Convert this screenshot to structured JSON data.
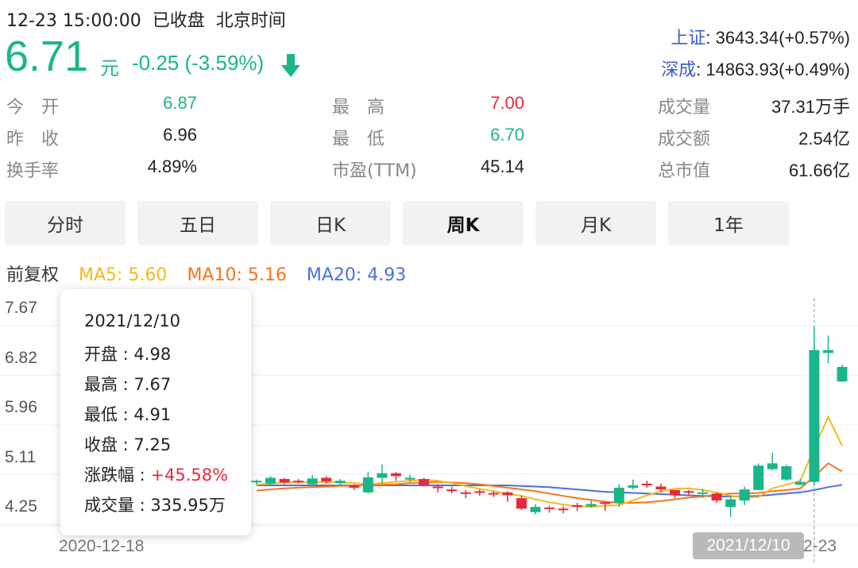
{
  "header": {
    "datetime": "12-23 15:00:00",
    "status": "已收盘",
    "timezone": "北京时间",
    "price": "6.71",
    "unit": "元",
    "change": "-0.25 (-3.59%)",
    "direction_icon": "arrow-down-icon",
    "down_color": "#1bb58a",
    "up_color": "#e8293c"
  },
  "indices": [
    {
      "name": "上证",
      "value": ": 3643.34(+0.57%)"
    },
    {
      "name": "深成",
      "value": ": 14863.93(+0.49%)"
    }
  ],
  "stats": [
    {
      "label": "今　开",
      "value": "6.87",
      "color": "#1bb58a"
    },
    {
      "label": "昨　收",
      "value": "6.96",
      "color": "#222222"
    },
    {
      "label": "换手率",
      "value": "4.89%",
      "color": "#222222"
    },
    {
      "label": "最　高",
      "value": "7.00",
      "color": "#e8293c"
    },
    {
      "label": "最　低",
      "value": "6.70",
      "color": "#1bb58a"
    },
    {
      "label": "市盈(TTM)",
      "value": "45.14",
      "color": "#222222"
    },
    {
      "label": "成交量",
      "value": "37.31万手",
      "color": "#222222"
    },
    {
      "label": "成交额",
      "value": "2.54亿",
      "color": "#222222"
    },
    {
      "label": "总市值",
      "value": "61.66亿",
      "color": "#222222"
    }
  ],
  "tabs": [
    {
      "label": "分时",
      "active": false
    },
    {
      "label": "五日",
      "active": false
    },
    {
      "label": "日K",
      "active": false
    },
    {
      "label": "周K",
      "active": true
    },
    {
      "label": "月K",
      "active": false
    },
    {
      "label": "1年",
      "active": false
    }
  ],
  "legend": {
    "adjust": "前复权",
    "ma5": "MA5: 5.60",
    "ma10": "MA10: 5.16",
    "ma20": "MA20: 4.93",
    "ma5_color": "#f5b81c",
    "ma10_color": "#f5751c",
    "ma20_color": "#4a6fe0"
  },
  "tooltip": {
    "date": "2021/12/10",
    "open": "开盘 : 4.98",
    "high": "最高 : 7.67",
    "low": "最低 : 4.91",
    "close": "收盘 : 7.25",
    "change_label": "涨跌幅 : ",
    "change_value": "+45.58%",
    "volume": "成交量 : 335.95万"
  },
  "chart_data": {
    "type": "candlestick",
    "y_ticks": [
      "7.67",
      "6.82",
      "5.96",
      "5.11",
      "4.25"
    ],
    "ylim": [
      4.0,
      7.9
    ],
    "x_start_label": "2020-12-18",
    "x_highlight_label": "2021/12/10",
    "x_end_label": "2-23",
    "grid": true,
    "candles": [
      [
        5.0,
        5.02,
        4.93,
        4.98
      ],
      [
        5.05,
        5.08,
        4.92,
        4.95
      ],
      [
        4.97,
        5.05,
        4.94,
        5.03
      ],
      [
        5.0,
        5.03,
        4.96,
        5.0
      ],
      [
        5.04,
        5.1,
        4.92,
        4.94
      ],
      [
        4.99,
        5.08,
        4.95,
        5.05
      ],
      [
        5.0,
        5.03,
        4.92,
        4.96
      ],
      [
        4.88,
        4.94,
        4.84,
        4.92
      ],
      [
        5.06,
        5.15,
        4.78,
        4.8
      ],
      [
        5.13,
        5.28,
        4.95,
        5.05
      ],
      [
        5.08,
        5.15,
        5.0,
        5.13
      ],
      [
        5.05,
        5.1,
        4.98,
        5.02
      ],
      [
        4.93,
        5.05,
        4.9,
        5.03
      ],
      [
        4.88,
        4.94,
        4.8,
        4.9
      ],
      [
        4.82,
        4.9,
        4.78,
        4.85
      ],
      [
        4.78,
        4.84,
        4.7,
        4.8
      ],
      [
        4.8,
        4.85,
        4.74,
        4.82
      ],
      [
        4.78,
        4.82,
        4.72,
        4.79
      ],
      [
        4.75,
        4.82,
        4.64,
        4.8
      ],
      [
        4.52,
        4.75,
        4.5,
        4.7
      ],
      [
        4.55,
        4.6,
        4.42,
        4.46
      ],
      [
        4.52,
        4.57,
        4.45,
        4.54
      ],
      [
        4.5,
        4.56,
        4.44,
        4.52
      ],
      [
        4.55,
        4.62,
        4.48,
        4.58
      ],
      [
        4.6,
        4.66,
        4.54,
        4.56
      ],
      [
        4.6,
        4.62,
        4.48,
        4.63
      ],
      [
        4.88,
        4.94,
        4.55,
        4.62
      ],
      [
        4.92,
        5.02,
        4.85,
        4.88
      ],
      [
        4.92,
        5.0,
        4.88,
        4.95
      ],
      [
        4.85,
        4.95,
        4.8,
        4.9
      ],
      [
        4.75,
        4.84,
        4.7,
        4.84
      ],
      [
        4.8,
        4.84,
        4.76,
        4.82
      ],
      [
        4.8,
        4.86,
        4.7,
        4.78
      ],
      [
        4.66,
        4.8,
        4.62,
        4.78
      ],
      [
        4.68,
        4.75,
        4.38,
        4.55
      ],
      [
        4.85,
        4.9,
        4.58,
        4.66
      ],
      [
        5.26,
        5.3,
        4.84,
        4.84
      ],
      [
        5.3,
        5.48,
        5.18,
        5.2
      ],
      [
        5.25,
        5.28,
        5.0,
        5.02
      ],
      [
        4.98,
        5.03,
        4.93,
        4.93
      ],
      [
        7.25,
        7.67,
        4.91,
        4.98
      ],
      [
        7.25,
        7.5,
        7.02,
        7.2
      ],
      [
        6.96,
        7.0,
        6.7,
        6.71
      ]
    ],
    "ma5": [
      4.93,
      4.95,
      4.97,
      4.98,
      4.97,
      4.98,
      4.97,
      4.96,
      4.94,
      4.96,
      4.98,
      5.0,
      5.02,
      5.0,
      4.96,
      4.91,
      4.86,
      4.82,
      4.78,
      4.74,
      4.68,
      4.63,
      4.59,
      4.56,
      4.55,
      4.57,
      4.58,
      4.66,
      4.75,
      4.82,
      4.86,
      4.87,
      4.84,
      4.8,
      4.74,
      4.71,
      4.72,
      4.87,
      4.93,
      5.0,
      5.56,
      6.1,
      5.6
    ],
    "ma10": [
      4.83,
      4.85,
      4.87,
      4.88,
      4.89,
      4.9,
      4.91,
      4.92,
      4.92,
      4.93,
      4.94,
      4.96,
      4.97,
      4.98,
      4.97,
      4.96,
      4.94,
      4.91,
      4.88,
      4.85,
      4.82,
      4.78,
      4.74,
      4.7,
      4.67,
      4.64,
      4.62,
      4.62,
      4.63,
      4.65,
      4.68,
      4.71,
      4.73,
      4.76,
      4.78,
      4.78,
      4.79,
      4.82,
      4.84,
      4.87,
      5.07,
      5.3,
      5.16
    ],
    "ma20": [
      4.92,
      4.92,
      4.92,
      4.92,
      4.92,
      4.92,
      4.92,
      4.92,
      4.92,
      4.92,
      4.92,
      4.92,
      4.92,
      4.92,
      4.92,
      4.92,
      4.92,
      4.92,
      4.92,
      4.91,
      4.9,
      4.89,
      4.87,
      4.85,
      4.83,
      4.81,
      4.8,
      4.79,
      4.78,
      4.77,
      4.76,
      4.75,
      4.74,
      4.73,
      4.73,
      4.73,
      4.74,
      4.76,
      4.78,
      4.8,
      4.84,
      4.89,
      4.93
    ]
  }
}
